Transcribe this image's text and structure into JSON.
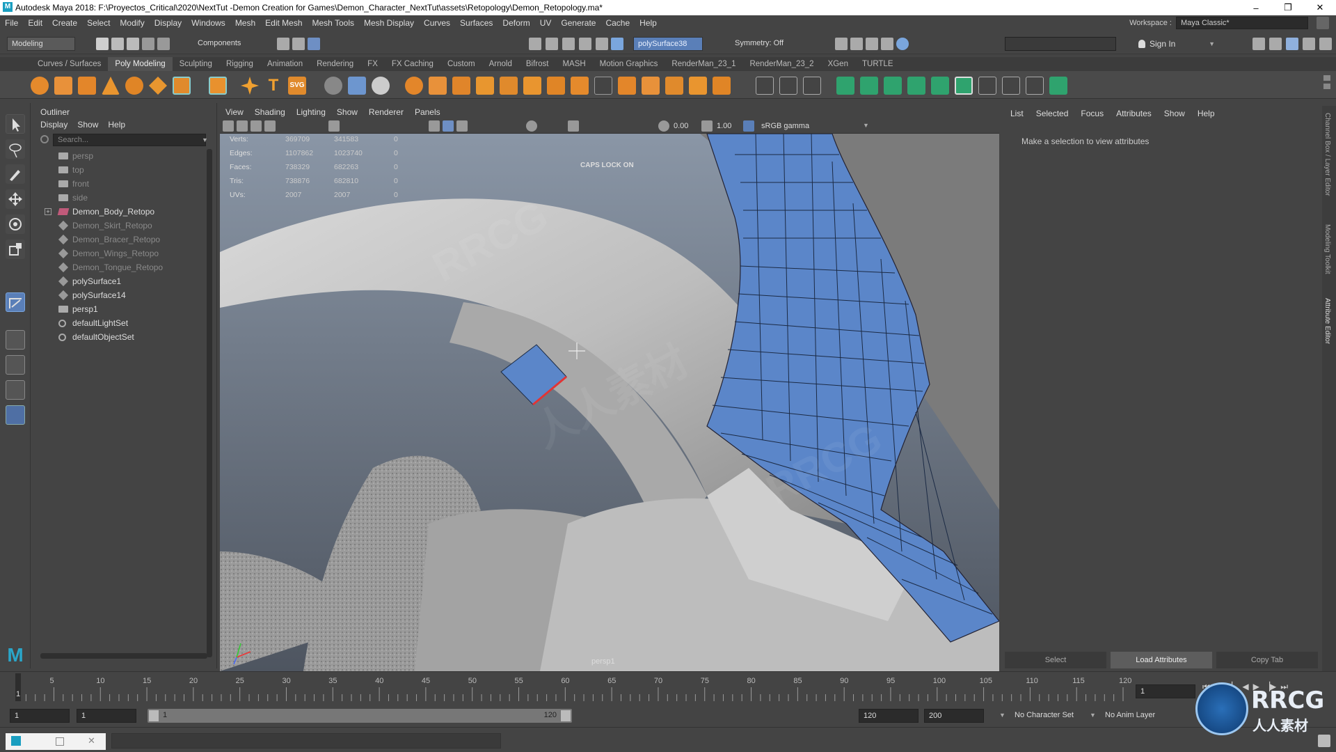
{
  "window": {
    "title": "Autodesk Maya 2018: F:\\Proyectos_Critical\\2020\\NextTut -Demon Creation for Games\\Demon_Character_NextTut\\assets\\Retopology\\Demon_Retopology.ma*",
    "minimize": "–",
    "maximize": "❐",
    "close": "✕"
  },
  "menubar": {
    "items": [
      "File",
      "Edit",
      "Create",
      "Select",
      "Modify",
      "Display",
      "Windows",
      "Mesh",
      "Edit Mesh",
      "Mesh Tools",
      "Mesh Display",
      "Curves",
      "Surfaces",
      "Deform",
      "UV",
      "Generate",
      "Cache",
      "Help"
    ],
    "workspace_label": "Workspace :",
    "workspace_value": "Maya Classic*"
  },
  "statusline": {
    "menuset": "Modeling",
    "components": "Components",
    "selected_object": "polySurface38",
    "symmetry": "Symmetry: Off",
    "sign_in": "Sign In"
  },
  "shelf": {
    "tabs": [
      "Curves / Surfaces",
      "Poly Modeling",
      "Sculpting",
      "Rigging",
      "Animation",
      "Rendering",
      "FX",
      "FX Caching",
      "Custom",
      "Arnold",
      "Bifrost",
      "MASH",
      "Motion Graphics",
      "RenderMan_23_1",
      "RenderMan_23_2",
      "XGen",
      "TURTLE"
    ],
    "active_tab": "Poly Modeling",
    "svg_label": "SVG",
    "text_label": "T"
  },
  "outliner": {
    "title": "Outliner",
    "menu": [
      "Display",
      "Show",
      "Help"
    ],
    "search_placeholder": "Search...",
    "items": [
      {
        "label": "persp",
        "type": "camera",
        "dim": true
      },
      {
        "label": "top",
        "type": "camera",
        "dim": true
      },
      {
        "label": "front",
        "type": "camera",
        "dim": true
      },
      {
        "label": "side",
        "type": "camera",
        "dim": true
      },
      {
        "label": "Demon_Body_Retopo",
        "type": "group",
        "dim": false,
        "expander": "+"
      },
      {
        "label": "Demon_Skirt_Retopo",
        "type": "mesh",
        "dim": true
      },
      {
        "label": "Demon_Bracer_Retopo",
        "type": "mesh",
        "dim": true
      },
      {
        "label": "Demon_Wings_Retopo",
        "type": "mesh",
        "dim": true
      },
      {
        "label": "Demon_Tongue_Retopo",
        "type": "mesh",
        "dim": true
      },
      {
        "label": "polySurface1",
        "type": "mesh",
        "dim": false
      },
      {
        "label": "polySurface14",
        "type": "mesh",
        "dim": false
      },
      {
        "label": "persp1",
        "type": "camera",
        "dim": false
      },
      {
        "label": "defaultLightSet",
        "type": "set",
        "dim": false
      },
      {
        "label": "defaultObjectSet",
        "type": "set",
        "dim": false
      }
    ]
  },
  "viewport": {
    "menu": [
      "View",
      "Shading",
      "Lighting",
      "Show",
      "Renderer",
      "Panels"
    ],
    "near_clip": "0.00",
    "far_clip": "1.00",
    "color_space": "sRGB gamma",
    "caps_lock": "CAPS LOCK ON",
    "camera": "persp1",
    "hud": [
      {
        "label": "Verts:",
        "a": "369709",
        "b": "341583",
        "c": "0"
      },
      {
        "label": "Edges:",
        "a": "1107862",
        "b": "1023740",
        "c": "0"
      },
      {
        "label": "Faces:",
        "a": "738329",
        "b": "682263",
        "c": "0"
      },
      {
        "label": "Tris:",
        "a": "738876",
        "b": "682810",
        "c": "0"
      },
      {
        "label": "UVs:",
        "a": "2007",
        "b": "2007",
        "c": "0"
      }
    ],
    "watermark": "RRCG",
    "watermark_cn": "人人素材"
  },
  "attribute_editor": {
    "menu": [
      "List",
      "Selected",
      "Focus",
      "Attributes",
      "Show",
      "Help"
    ],
    "message": "Make a selection to view attributes",
    "buttons": [
      "Select",
      "Load Attributes",
      "Copy Tab"
    ],
    "side_tabs": [
      "Channel Box / Layer Editor",
      "Modeling Toolkit",
      "Attribute Editor"
    ]
  },
  "timeline": {
    "ticks": [
      "5",
      "10",
      "15",
      "20",
      "25",
      "30",
      "35",
      "40",
      "45",
      "50",
      "55",
      "60",
      "65",
      "70",
      "75",
      "80",
      "85",
      "90",
      "95",
      "100",
      "105",
      "110",
      "115",
      "120"
    ],
    "current_frame": "1",
    "first_tick": "1"
  },
  "range": {
    "start": "1",
    "playback_start": "1",
    "slider_start": "1",
    "slider_end": "120",
    "playback_end": "120",
    "end": "200",
    "character_set": "No Character Set",
    "anim_layer": "No Anim Layer"
  },
  "logo": {
    "brand": "RRCG",
    "sub": "人人素材"
  },
  "colors": {
    "accent_blue": "#5b86c9",
    "selection": "#7aa6dd",
    "titlebar": "#ffffff",
    "ui_bg": "#444444"
  }
}
